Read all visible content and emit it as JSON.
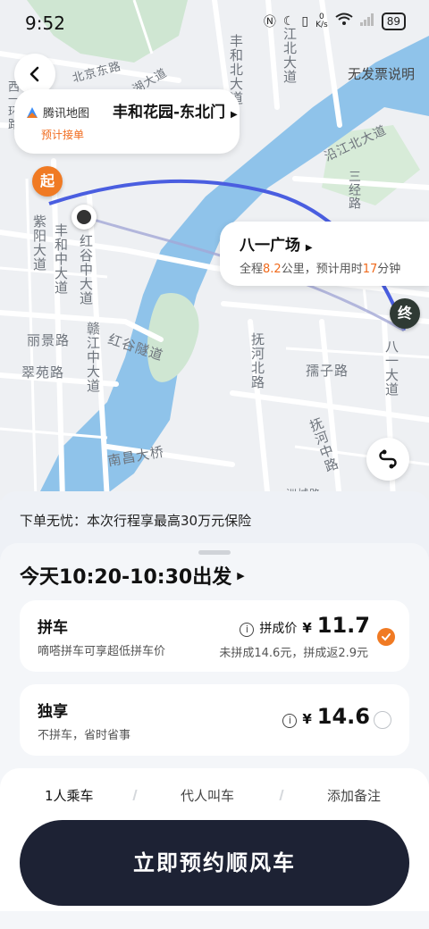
{
  "status_bar": {
    "time": "9:52",
    "net_speed_value": "0",
    "net_speed_unit": "K/s",
    "battery": "89"
  },
  "header": {
    "no_invoice_link": "无发票说明"
  },
  "pickup": {
    "brand": "腾讯地图",
    "tag": "预计接单",
    "name": "丰和花园-东北门"
  },
  "destination": {
    "name": "八一广场",
    "info_prefix": "全程",
    "distance": "8.2",
    "distance_unit": "公里，预计用时",
    "duration": "17",
    "duration_unit": "分钟"
  },
  "pins": {
    "start": "起",
    "end": "终"
  },
  "map_labels": {
    "fenghe_north": "丰和北大道",
    "fenghe_middle": "丰和中大道",
    "honggu_middle": "红谷中大道",
    "ganjiang_middle": "赣江中大道",
    "jiangbei": "江北大道",
    "yanjiang_north": "沿江北大道",
    "sanjing": "三经路",
    "lijing": "丽景路",
    "cuiyuan": "翠苑路",
    "honggu_tunnel": "红谷隧道",
    "fuhe_north": "抚河北路",
    "fuhe_middle": "抚河中路",
    "ruzi": "孺子路",
    "bayi": "八一大道",
    "nanchang_bridge": "南昌大桥",
    "xiyi": "西一环路",
    "ziyang": "紫阳大道",
    "ziyang2": "北京东路",
    "hunan": "湖大道",
    "misc_bottom": "洲城路"
  },
  "sheet": {
    "insurance": "下单无忧：本次行程享最高30万元保险",
    "depart_time": "今天10:20-10:30出发",
    "options": [
      {
        "title": "拼车",
        "subtitle": "嘀嗒拼车可享超低拼车价",
        "price_label": "拼成价",
        "currency": "¥",
        "price": "11.7",
        "note": "未拼成14.6元，拼成返2.9元",
        "selected": true
      },
      {
        "title": "独享",
        "subtitle": "不拼车，省时省事",
        "price_label": "",
        "currency": "¥",
        "price": "14.6",
        "note": "",
        "selected": false
      }
    ],
    "tabs": [
      "1人乘车",
      "代人叫车",
      "添加备注"
    ],
    "cta": "立即预约顺风车"
  },
  "colors": {
    "accent": "#f07a23",
    "route": "#4a5ee0",
    "cta_bg": "#1d2234",
    "water": "#8fc3ea"
  }
}
